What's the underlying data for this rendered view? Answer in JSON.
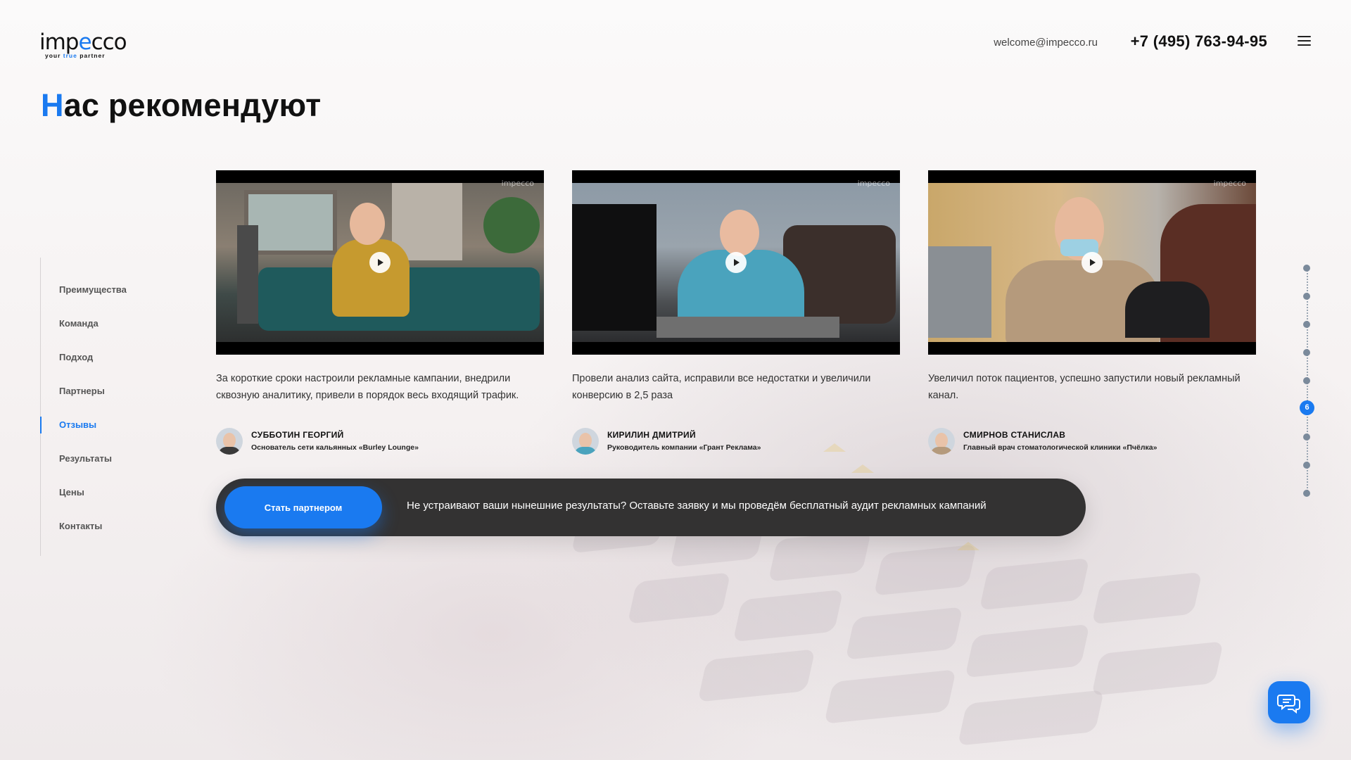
{
  "brand": {
    "logo_text_pre": "imp",
    "logo_text_o": "e",
    "logo_text_post": "cco",
    "tagline_pre": "your",
    "tagline_accent": "true",
    "tagline_post": "partner",
    "accent_color": "#1a7af0"
  },
  "header": {
    "email": "welcome@impecco.ru",
    "phone": "+7 (495) 763-94-95",
    "menu_icon": "hamburger-icon"
  },
  "page": {
    "title_first_letter": "Н",
    "title_rest": "ас рекомендуют"
  },
  "sidebar": {
    "items": [
      {
        "label": "Преимущества"
      },
      {
        "label": "Команда"
      },
      {
        "label": "Подход"
      },
      {
        "label": "Партнеры"
      },
      {
        "label": "Отзывы",
        "active": true
      },
      {
        "label": "Результаты"
      },
      {
        "label": "Цены"
      },
      {
        "label": "Контакты"
      }
    ]
  },
  "testimonials": [
    {
      "video_watermark": "impecco",
      "quote": "За короткие сроки настроили рекламные кампании, внедрили сквозную аналитику, привели в порядок весь входящий трафик.",
      "author_name": "СУББОТИН ГЕОРГИЙ",
      "author_role": "Основатель сети кальянных «Burley Lounge»"
    },
    {
      "video_watermark": "impecco",
      "quote": "Провели анализ сайта, исправили все недостатки и увеличили конверсию в 2,5 раза",
      "author_name": "КИРИЛИН ДМИТРИЙ",
      "author_role": "Руководитель компании «Грант Реклама»"
    },
    {
      "video_watermark": "impecco",
      "quote": "Увеличил поток пациентов, успешно запустили новый рекламный канал.",
      "author_name": "СМИРНОВ СТАНИСЛАВ",
      "author_role": "Главный врач стоматологической клиники «Пчёлка»"
    }
  ],
  "cta": {
    "button_label": "Стать партнером",
    "text": "Не устраивают ваши нынешние результаты? Оставьте заявку и мы проведём бесплатный аудит рекламных кампаний"
  },
  "section_nav": {
    "total": 9,
    "active_index": 6,
    "active_label": "6"
  },
  "chat": {
    "icon": "chat-bubbles-icon"
  }
}
